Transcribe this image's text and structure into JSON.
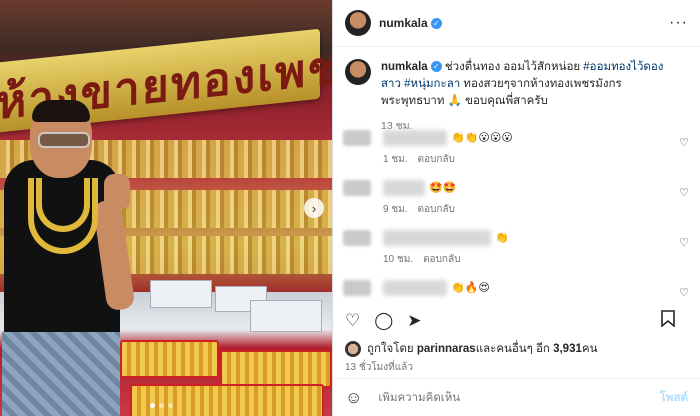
{
  "post": {
    "username": "numkala",
    "photo": {
      "sign_text": "ห้างขายทองเพชรมังกร"
    },
    "caption": {
      "username": "numkala",
      "text_before": "ช่วงตื่นทอง ออมไว้สักหน่อย ",
      "hashtags": [
        "#ออมทองไว้ดองสาว",
        "#หนุ่มกะลา"
      ],
      "text_after": " ทองสวยๆจากห้างทองเพชรมังกร พระพุทธบาท 🙏 ขอบคุณพี่สาครับ",
      "time": "13 ชม."
    },
    "comments": [
      {
        "emoji": "👏👏😮😮😮",
        "time": "1 ชม.",
        "reply": "ตอบกลับ"
      },
      {
        "emoji": "🤩🤩",
        "time": "9 ชม.",
        "reply": "ตอบกลับ"
      },
      {
        "emoji": "👏",
        "time": "10 ชม.",
        "reply": "ตอบกลับ"
      },
      {
        "emoji": "👏🔥😍",
        "time": "",
        "reply": ""
      }
    ],
    "likes": {
      "prefix": "ถูกใจโดย ",
      "user": "parinnaras",
      "middle": " และคนอื่นๆ อีก ",
      "count": "3,931",
      "suffix": " คน"
    },
    "post_time": "13 ชั่วโมงที่แล้ว",
    "add_comment_placeholder": "เพิ่มความคิดเห็น",
    "post_button": "โพสต์",
    "icons": {
      "more": "more-icon",
      "heart": "heart-icon",
      "comment": "comment-icon",
      "share": "share-icon",
      "bookmark": "bookmark-icon",
      "emoji": "emoji-icon",
      "next": "chevron-right-icon",
      "verified": "verified-badge-icon"
    },
    "colors": {
      "link": "#00376b",
      "verified": "#3897f0",
      "post_button": "#b2dffc",
      "muted": "#737373"
    }
  }
}
